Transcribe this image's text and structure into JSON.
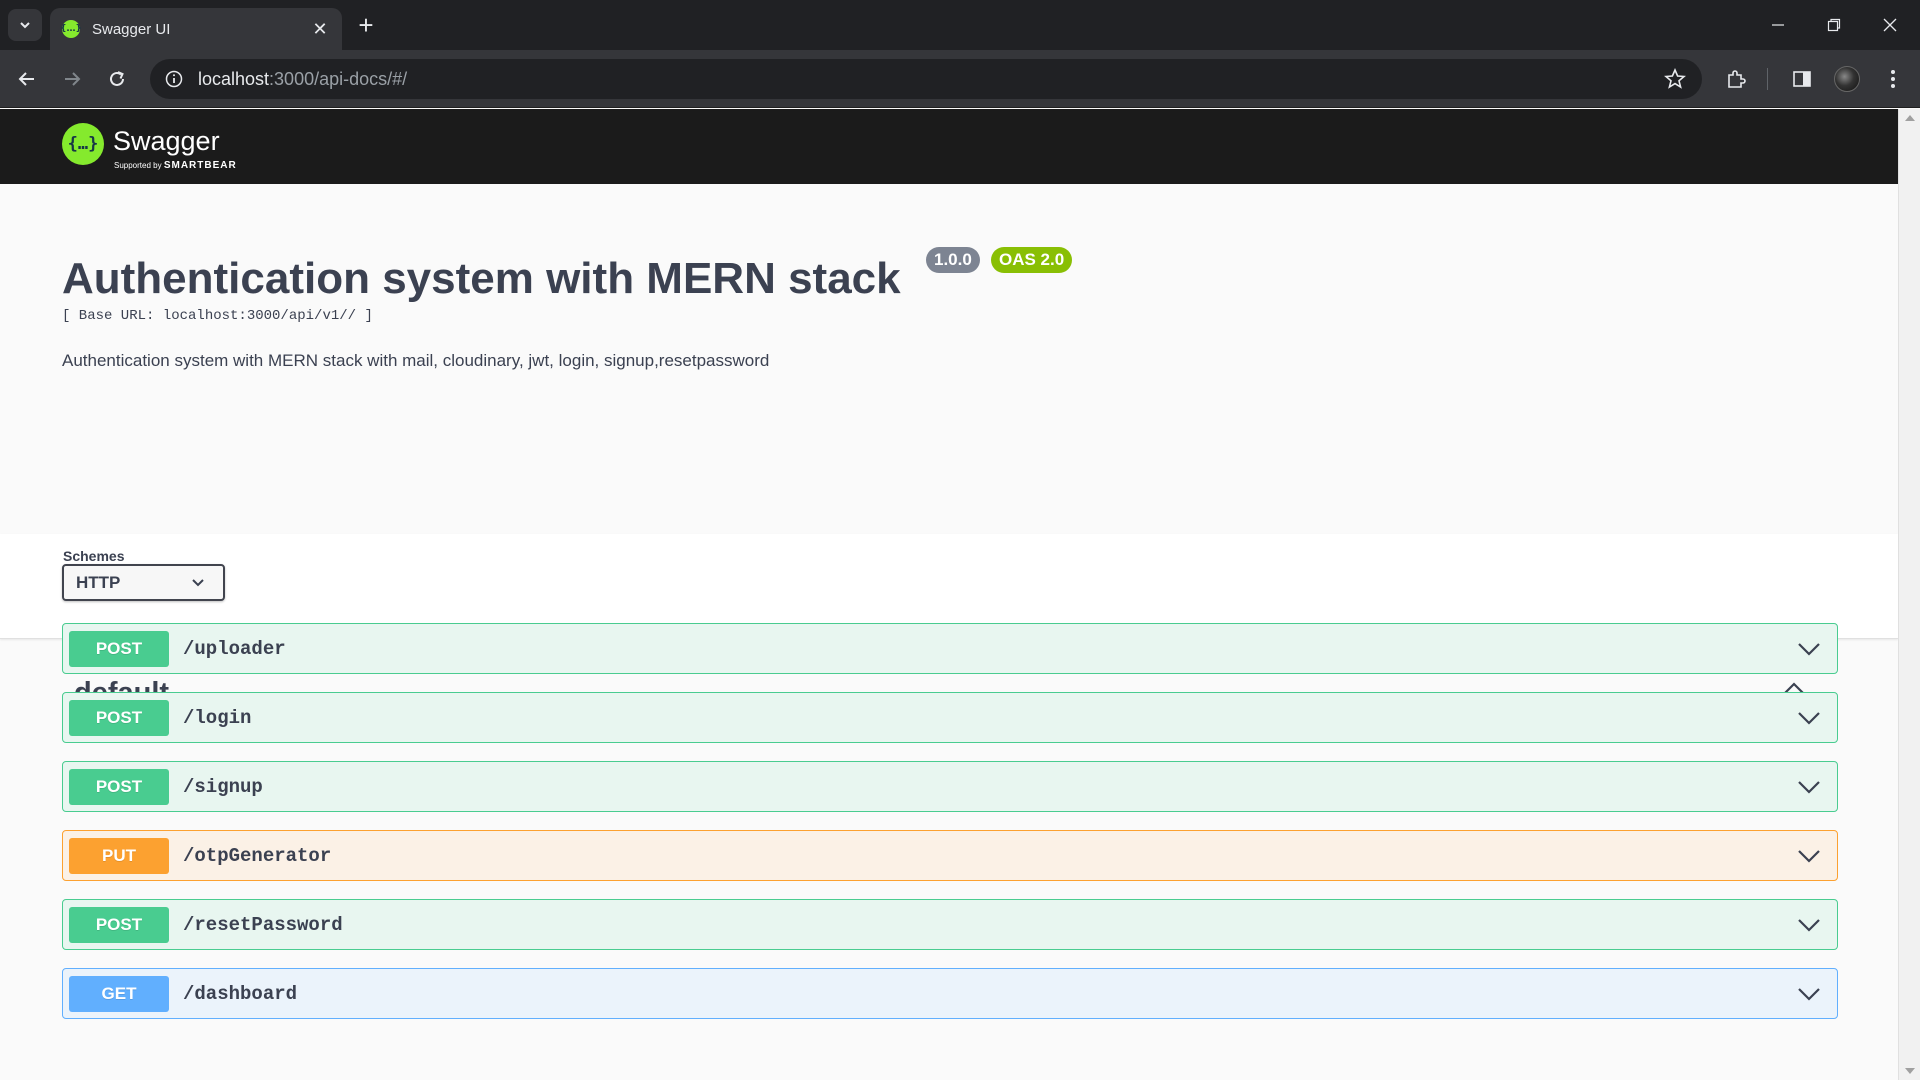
{
  "browser": {
    "tab_title": "Swagger UI",
    "url_host": "localhost",
    "url_path": ":3000/api-docs/#/"
  },
  "swagger": {
    "brand": "Swagger",
    "supported_by": "Supported by",
    "smartbear": "SMARTBEAR"
  },
  "info": {
    "title": "Authentication system with MERN stack",
    "version": "1.0.0",
    "oas": "OAS 2.0",
    "base_url": "[ Base URL: localhost:3000/api/v1// ]",
    "description": "Authentication system with MERN stack with mail, cloudinary, jwt, login, signup,resetpassword"
  },
  "schemes": {
    "label": "Schemes",
    "selected": "HTTP"
  },
  "tag": {
    "name": "default"
  },
  "operations": [
    {
      "method": "POST",
      "path": "/uploader"
    },
    {
      "method": "POST",
      "path": "/login"
    },
    {
      "method": "POST",
      "path": "/signup"
    },
    {
      "method": "PUT",
      "path": "/otpGenerator"
    },
    {
      "method": "POST",
      "path": "/resetPassword"
    },
    {
      "method": "GET",
      "path": "/dashboard"
    }
  ],
  "colors": {
    "post": "#49cc90",
    "put": "#fca130",
    "get": "#61affe",
    "swagger_green": "#85ea2d"
  }
}
